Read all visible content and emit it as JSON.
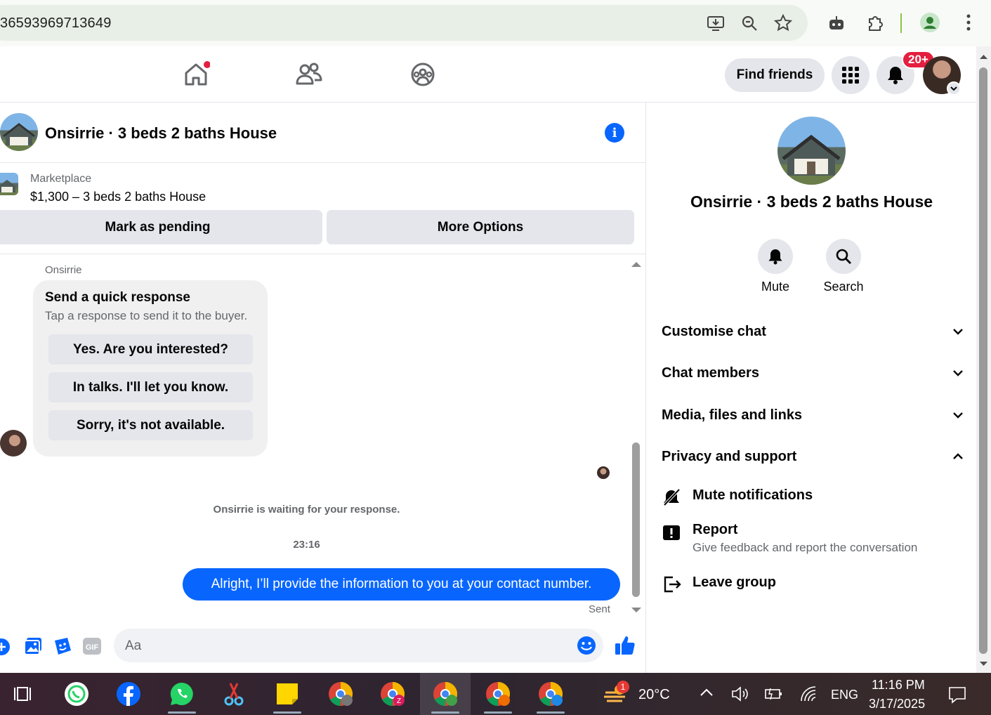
{
  "browser": {
    "url": "36593969713649"
  },
  "fb_nav": {
    "find_friends": "Find friends",
    "notif_count": "20+"
  },
  "chat": {
    "title": "Onsirrie · 3 beds 2 baths House",
    "marketplace_label": "Marketplace",
    "listing": "$1,300 – 3 beds 2 baths House",
    "mark_pending": "Mark as pending",
    "more_options": "More Options",
    "sender_name": "Onsirrie",
    "quick_response_title": "Send a quick response",
    "quick_response_sub": "Tap a response to send it to the buyer.",
    "quick_responses": [
      "Yes. Are you interested?",
      "In talks. I'll let you know.",
      "Sorry, it's not available."
    ],
    "waiting": "Onsirrie is waiting for your response.",
    "time": "23:16",
    "my_message": "Alright, I’ll provide the information to you at your contact number.",
    "sent": "Sent",
    "composer_placeholder": "Aa"
  },
  "panel": {
    "title": "Onsirrie · 3 beds 2 baths House",
    "mute": "Mute",
    "search": "Search",
    "sections": [
      "Customise chat",
      "Chat members",
      "Media, files and links",
      "Privacy and support"
    ],
    "mute_notifications": "Mute notifications",
    "report": "Report",
    "report_sub": "Give feedback and report the conversation",
    "leave_group": "Leave group"
  },
  "taskbar": {
    "weather_badge": "1",
    "temperature": "20°C",
    "language": "ENG",
    "time": "11:16 PM",
    "date": "3/17/2025"
  },
  "colors": {
    "fb_blue": "#0866ff",
    "badge_red": "#e41e3f"
  }
}
